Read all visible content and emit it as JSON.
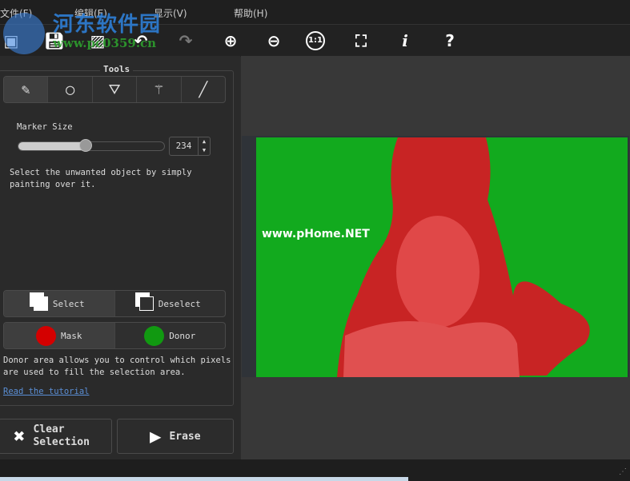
{
  "menu": {
    "file": "文件(F)",
    "edit": "编辑(E)",
    "view": "显示(V)",
    "help": "帮助(H)"
  },
  "watermark": {
    "site_cn": "河东软件园",
    "site_url": "www.pc0359.cn",
    "image_text": "www.pHome.NET"
  },
  "toolbar": {
    "one_to_one": "1:1",
    "info": "i",
    "help": "?"
  },
  "tools": {
    "title": "Tools",
    "marker_size_label": "Marker Size",
    "marker_size_value": "234",
    "marker_size_fraction": 0.46,
    "hint": "Select the unwanted object by simply painting over it.",
    "select": "Select",
    "deselect": "Deselect",
    "mask": "Mask",
    "donor": "Donor",
    "donor_hint": "Donor area allows you to control which pixels are used to fill the selection area.",
    "tutorial_link": "Read the tutorial"
  },
  "actions": {
    "clear_line1": "Clear",
    "clear_line2": "Selection",
    "erase": "Erase"
  },
  "colors": {
    "mask": "#d40000",
    "donor": "#119911",
    "image_bg": "#12aa1e",
    "selection": "#d83030",
    "link": "#5b8fd6"
  }
}
